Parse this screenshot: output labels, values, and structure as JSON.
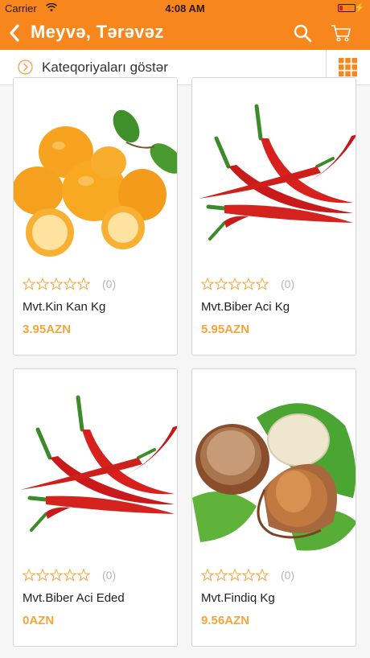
{
  "status_bar": {
    "carrier": "Carrier",
    "time": "4:08 AM"
  },
  "nav": {
    "title": "Meyvə, Tərəvəz",
    "accent_color": "#f7871c"
  },
  "category_bar": {
    "label": "Kateqoriyaları göstər"
  },
  "products": [
    {
      "name": "Mvt.Kin Kan Kg",
      "price": "3.95AZN",
      "rating": 0,
      "review_count": "(0)",
      "image": "kumquat"
    },
    {
      "name": "Mvt.Biber Aci Kg",
      "price": "5.95AZN",
      "rating": 0,
      "review_count": "(0)",
      "image": "chili-pepper"
    },
    {
      "name": "Mvt.Biber Aci Eded",
      "price": "0AZN",
      "rating": 0,
      "review_count": "(0)",
      "image": "chili-pepper"
    },
    {
      "name": "Mvt.Findiq Kg",
      "price": "9.56AZN",
      "rating": 0,
      "review_count": "(0)",
      "image": "hazelnut"
    }
  ]
}
